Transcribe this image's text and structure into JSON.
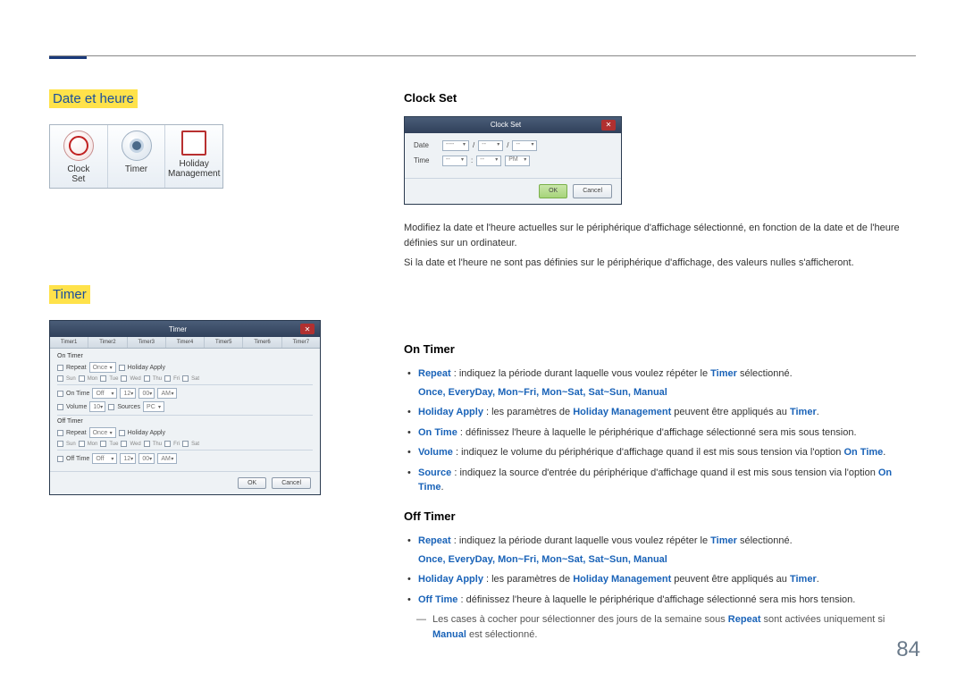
{
  "page": {
    "number": "84"
  },
  "left": {
    "section1_title": "Date et heure",
    "tabs": {
      "clock": "Clock\nSet",
      "timer": "Timer",
      "holiday": "Holiday\nManagement"
    },
    "section2_title": "Timer"
  },
  "clockset_dlg": {
    "title": "Clock Set",
    "date_label": "Date",
    "time_label": "Time",
    "pm": "PM",
    "sep_slash": "/",
    "sep_dash": "--",
    "placeholder": "----",
    "ok": "OK",
    "cancel": "Cancel"
  },
  "timer_dlg": {
    "title": "Timer",
    "tabs": [
      "Timer1",
      "Timer2",
      "Timer3",
      "Timer4",
      "Timer5",
      "Timer6",
      "Timer7"
    ],
    "on_timer": "On Timer",
    "off_timer": "Off Timer",
    "repeat": "Repeat",
    "once": "Once",
    "holiday_apply": "Holiday Apply",
    "days": [
      "Sun",
      "Mon",
      "Tue",
      "Wed",
      "Thu",
      "Fri",
      "Sat"
    ],
    "on_time": "On Time",
    "off_time": "Off Time",
    "off": "Off",
    "volume": "Volume",
    "vol_val": "10",
    "sources": "Sources",
    "pc": "PC",
    "h12": "12",
    "m00": "00",
    "ampm": "AM",
    "ok": "OK",
    "cancel": "Cancel"
  },
  "right": {
    "clockset_h": "Clock Set",
    "cs_p1": "Modifiez la date et l'heure actuelles sur le périphérique d'affichage sélectionné, en fonction de la date et de l'heure définies sur un ordinateur.",
    "cs_p2": "Si la date et l'heure ne sont pas définies sur le périphérique d'affichage, des valeurs nulles s'afficheront.",
    "on_timer_h": "On Timer",
    "ot_li1_a": "Repeat",
    "ot_li1_b": " : indiquez la période durant laquelle vous voulez répéter le ",
    "ot_li1_c": "Timer",
    "ot_li1_d": " sélectionné.",
    "ot_opts": "Once, EveryDay, Mon~Fri, Mon~Sat, Sat~Sun, Manual",
    "ot_li2_a": "Holiday Apply",
    "ot_li2_b": " : les paramètres de ",
    "ot_li2_c": "Holiday Management",
    "ot_li2_d": " peuvent être appliqués au ",
    "ot_li2_e": "Timer",
    "ot_li2_f": ".",
    "ot_li3_a": "On Time",
    "ot_li3_b": " : définissez l'heure à laquelle le périphérique d'affichage sélectionné sera mis sous tension.",
    "ot_li4_a": "Volume",
    "ot_li4_b": " : indiquez le volume du périphérique d'affichage quand il est mis sous tension via l'option ",
    "ot_li4_c": "On Time",
    "ot_li4_d": ".",
    "ot_li5_a": "Source",
    "ot_li5_b": " : indiquez la source d'entrée du périphérique d'affichage quand il est mis sous tension via l'option ",
    "ot_li5_c": "On Time",
    "ot_li5_d": ".",
    "off_timer_h": "Off Timer",
    "ft_li3_a": "Off Time",
    "ft_li3_b": " : définissez l'heure à laquelle le périphérique d'affichage sélectionné sera mis hors tension.",
    "note_dash": "―",
    "note_a": "Les cases à cocher pour sélectionner des jours de la semaine sous ",
    "note_b": "Repeat",
    "note_c": " sont activées uniquement si ",
    "note_d": "Manual",
    "note_e": " est sélectionné."
  }
}
